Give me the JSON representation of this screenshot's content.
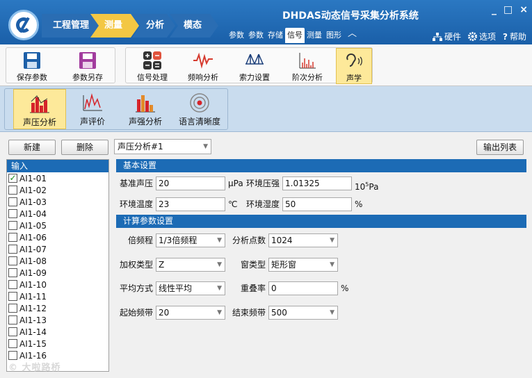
{
  "app": {
    "title": "DHDAS动态信号采集分析系统",
    "window_controls": [
      "_",
      "□",
      "×"
    ]
  },
  "workflow": [
    "工程管理",
    "测量",
    "分析",
    "模态"
  ],
  "ribbon_tabs": [
    "参数",
    "参数",
    "存储",
    "信号",
    "测量",
    "图形"
  ],
  "ribbon_active_tab": "信号",
  "top_links": {
    "hardware": "硬件",
    "options": "选项",
    "help": "帮助"
  },
  "ribbon": {
    "file_group": [
      "保存参数",
      "参数另存"
    ],
    "signal_group": [
      "信号处理",
      "频响分析",
      "索力设置",
      "阶次分析",
      "声学"
    ],
    "selected": "声学"
  },
  "sub_ribbon": {
    "items": [
      "声压分析",
      "声评价",
      "声强分析",
      "语言清晰度"
    ],
    "selected": "声压分析"
  },
  "toolbar": {
    "new_label": "新建",
    "delete_label": "删除",
    "analysis_select": "声压分析#1",
    "export_label": "输出列表"
  },
  "input_panel": {
    "title": "输入",
    "channels": [
      "AI1-01",
      "AI1-02",
      "AI1-03",
      "AI1-04",
      "AI1-05",
      "AI1-06",
      "AI1-07",
      "AI1-08",
      "AI1-09",
      "AI1-10",
      "AI1-11",
      "AI1-12",
      "AI1-13",
      "AI1-14",
      "AI1-15",
      "AI1-16"
    ],
    "checked": [
      "AI1-01"
    ]
  },
  "basic_settings": {
    "title": "基本设置",
    "ref_pressure_label": "基准声压",
    "ref_pressure": "20",
    "ref_pressure_unit": "μPa",
    "env_pressure_label": "环境压强",
    "env_pressure": "1.01325",
    "env_pressure_unit_base": "10",
    "env_pressure_unit_exp": "5",
    "env_pressure_unit_tail": "Pa",
    "temp_label": "环境温度",
    "temp": "23",
    "temp_unit": "℃",
    "humidity_label": "环境湿度",
    "humidity": "50",
    "humidity_unit": "%"
  },
  "calc_settings": {
    "title": "计算参数设置",
    "octave_label": "倍频程",
    "octave": "1/3倍频程",
    "points_label": "分析点数",
    "points": "1024",
    "weighting_label": "加权类型",
    "weighting": "Z",
    "window_label": "窗类型",
    "window": "矩形窗",
    "avg_label": "平均方式",
    "avg": "线性平均",
    "overlap_label": "重叠率",
    "overlap": "0",
    "overlap_unit": "%",
    "start_band_label": "起始频带",
    "start_band": "20",
    "end_band_label": "结束频带",
    "end_band": "500"
  },
  "watermark": "©  大啦路桥",
  "colors": {
    "header_blue": "#1c6bb5",
    "workflow_active": "#f3c744",
    "selected_bg": "#fde99a"
  }
}
